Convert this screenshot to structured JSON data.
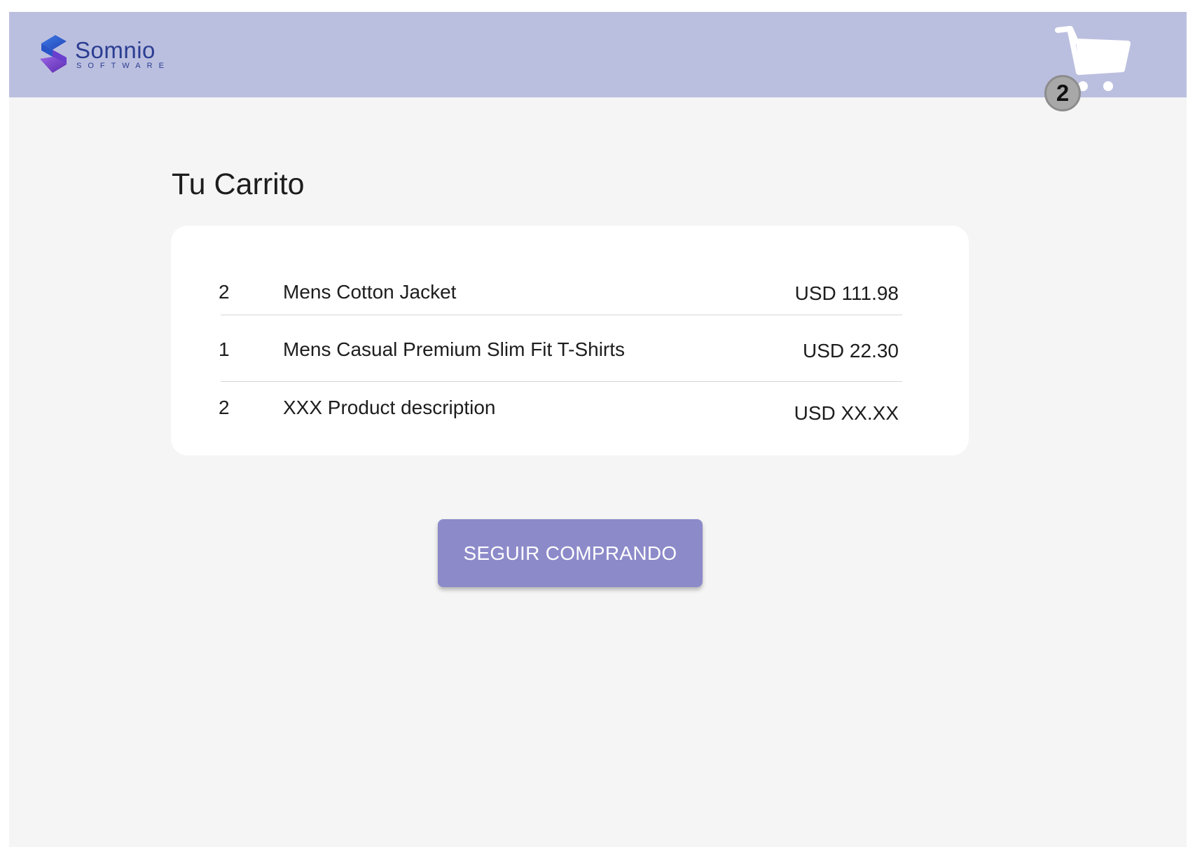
{
  "header": {
    "logo": {
      "name": "Somnio",
      "subtitle": "SOFTWARE"
    },
    "cart": {
      "icon": "shopping-cart-icon",
      "badge_count": "2"
    }
  },
  "main": {
    "title": "Tu Carrito",
    "items": [
      {
        "qty": "2",
        "description": "Mens Cotton Jacket",
        "price": "USD 111.98"
      },
      {
        "qty": "1",
        "description": "Mens Casual Premium Slim Fit T-Shirts",
        "price": "USD 22.30"
      },
      {
        "qty": "2",
        "description": "XXX Product description",
        "price": "USD XX.XX"
      }
    ],
    "continue_button": "SEGUIR COMPRANDO"
  },
  "colors": {
    "header_bg": "#bbbfdf",
    "page_bg": "#f4f5f4",
    "button_bg": "#8c8ac9",
    "logo_text": "#2b3d92",
    "badge_bg": "#a8a8a8"
  }
}
